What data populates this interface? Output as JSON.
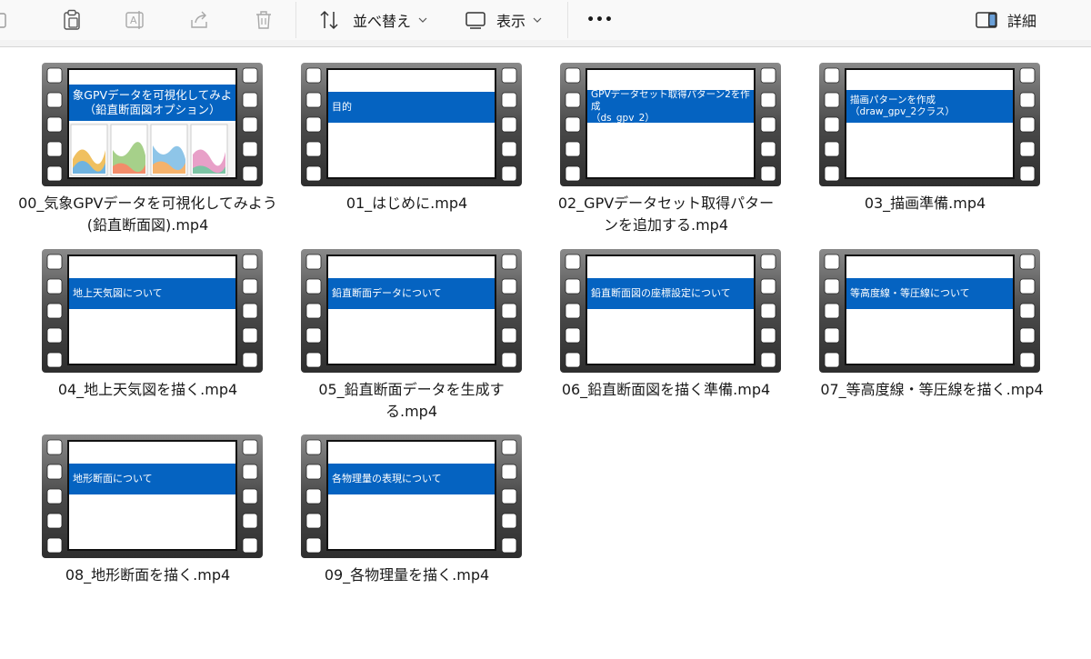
{
  "toolbar": {
    "sort_label": "並べ替え",
    "view_label": "表示",
    "more_label": "•••",
    "details_label": "詳細"
  },
  "files": [
    {
      "name": "00_気象GPVデータを可視化してみよう(鉛直断面図).mp4",
      "slide_title": "象GPVデータを可視化してみよ\n（鉛直断面図オプション）"
    },
    {
      "name": "01_はじめに.mp4",
      "slide_title": "目的"
    },
    {
      "name": "02_GPVデータセット取得パターンを追加する.mp4",
      "slide_title": "GPVデータセット取得パターン2を作成\n（ds_gpv_2）"
    },
    {
      "name": "03_描画準備.mp4",
      "slide_title": "描画パターンを作成\n（draw_gpv_2クラス）"
    },
    {
      "name": "04_地上天気図を描く.mp4",
      "slide_title": "地上天気図について"
    },
    {
      "name": "05_鉛直断面データを生成する.mp4",
      "slide_title": "鉛直断面データについて"
    },
    {
      "name": "06_鉛直断面図を描く準備.mp4",
      "slide_title": "鉛直断面図の座標設定について"
    },
    {
      "name": "07_等高度線・等圧線を描く.mp4",
      "slide_title": "等高度線・等圧線について"
    },
    {
      "name": "08_地形断面を描く.mp4",
      "slide_title": "地形断面について"
    },
    {
      "name": "09_各物理量を描く.mp4",
      "slide_title": "各物理量の表現について"
    }
  ]
}
